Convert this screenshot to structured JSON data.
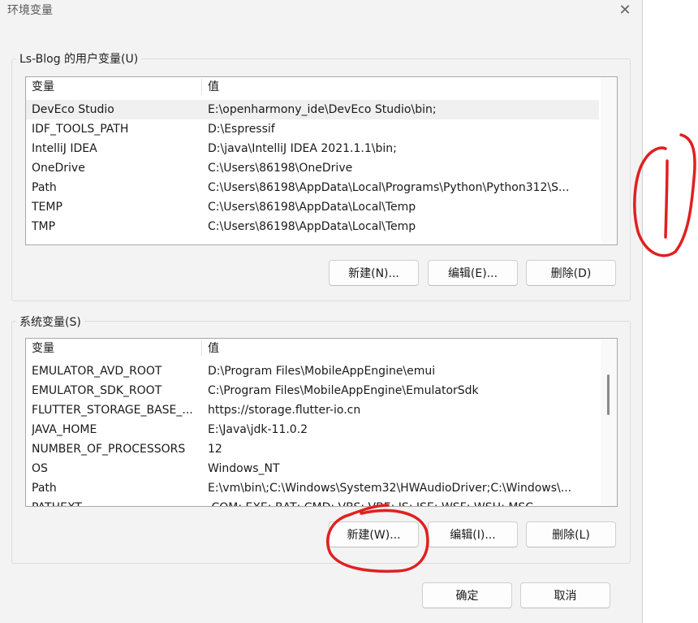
{
  "window": {
    "title": "环境变量",
    "close_icon": "close-icon"
  },
  "user_vars": {
    "label": "Ls-Blog 的用户变量(U)",
    "headers": {
      "name": "变量",
      "value": "值"
    },
    "rows": [
      {
        "name": "DevEco Studio",
        "value": "E:\\openharmony_ide\\DevEco Studio\\bin;"
      },
      {
        "name": "IDF_TOOLS_PATH",
        "value": "D:\\Espressif"
      },
      {
        "name": "IntelliJ IDEA",
        "value": "D:\\java\\IntelliJ IDEA 2021.1.1\\bin;"
      },
      {
        "name": "OneDrive",
        "value": "C:\\Users\\86198\\OneDrive"
      },
      {
        "name": "Path",
        "value": "C:\\Users\\86198\\AppData\\Local\\Programs\\Python\\Python312\\S..."
      },
      {
        "name": "TEMP",
        "value": "C:\\Users\\86198\\AppData\\Local\\Temp"
      },
      {
        "name": "TMP",
        "value": "C:\\Users\\86198\\AppData\\Local\\Temp"
      }
    ],
    "buttons": {
      "new": "新建(N)...",
      "edit": "编辑(E)...",
      "delete": "删除(D)"
    }
  },
  "system_vars": {
    "label": "系统变量(S)",
    "headers": {
      "name": "变量",
      "value": "值"
    },
    "rows": [
      {
        "name": "EMULATOR_AVD_ROOT",
        "value": "D:\\Program Files\\MobileAppEngine\\emui"
      },
      {
        "name": "EMULATOR_SDK_ROOT",
        "value": "C:\\Program Files\\MobileAppEngine\\EmulatorSdk"
      },
      {
        "name": "FLUTTER_STORAGE_BASE_...",
        "value": "https://storage.flutter-io.cn"
      },
      {
        "name": "JAVA_HOME",
        "value": "E:\\Java\\jdk-11.0.2"
      },
      {
        "name": "NUMBER_OF_PROCESSORS",
        "value": "12"
      },
      {
        "name": "OS",
        "value": "Windows_NT"
      },
      {
        "name": "Path",
        "value": "E:\\vm\\bin\\;C:\\Windows\\System32\\HWAudioDriver;C:\\Windows\\..."
      },
      {
        "name": "PATHEXT",
        "value": ".COM;.EXE;.BAT;.CMD;.VBS;.VBE;.JS;.JSE;.WSF;.WSH;.MSC"
      }
    ],
    "buttons": {
      "new": "新建(W)...",
      "edit": "编辑(I)...",
      "delete": "删除(L)"
    }
  },
  "footer": {
    "ok": "确定",
    "cancel": "取消"
  },
  "annotation": {
    "color": "#e02020"
  }
}
